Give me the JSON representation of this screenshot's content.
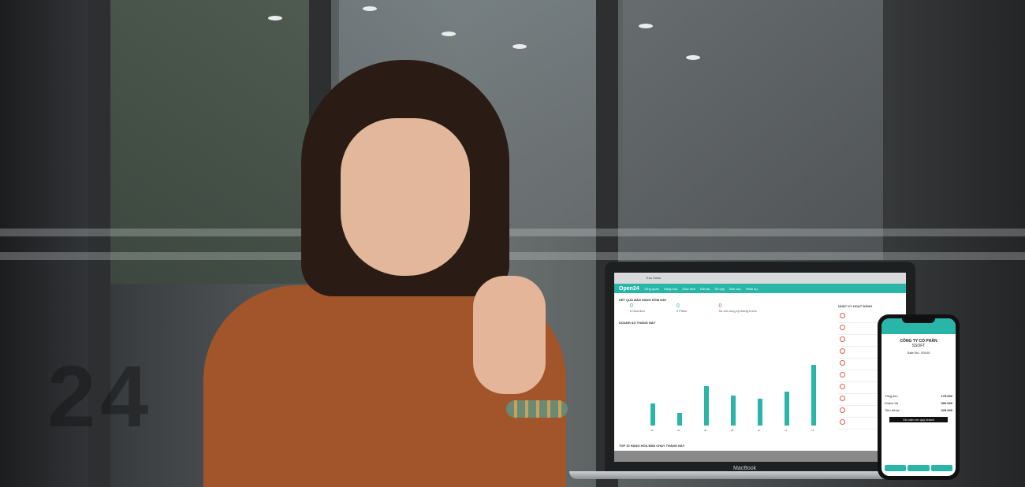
{
  "laptop": {
    "brand": "MacBook",
    "browser_title": "Trao Sinso",
    "app_logo": "Open24",
    "nav": [
      "Tổng quan",
      "Hàng hóa",
      "Giao dịch",
      "Đối tác",
      "Sổ quỹ",
      "Báo cáo",
      "Nhân sự"
    ],
    "panel_title": "KẾT QUẢ BÁN HÀNG HÔM NAY",
    "stats": [
      {
        "label": "0 Hóa đơn",
        "value": "0"
      },
      {
        "label": "0 Phiếu",
        "value": "0"
      },
      {
        "label": "So với cùng kỳ tháng trước",
        "value": "0"
      }
    ],
    "chart_title": "DOANH SỐ THÁNG NÀY",
    "activity_title": "NHẬT KÝ HOẠT ĐỘNG",
    "bottom_title": "TOP 10 HÀNG HÓA BÁN CHẠY THÁNG NÀY"
  },
  "phone": {
    "company": "CÔNG TY CỔ PHẦN",
    "company2": "SSOFT",
    "sale_no": "Sale No.: 00100",
    "total_label": "Tổng tiền",
    "total_value": "175.000",
    "paid_label": "Khách trả",
    "paid_value": "500.000",
    "change_label": "Tiền trả lại",
    "change_value": "325.000",
    "thanks": "Xin cảm ơn quý khách"
  },
  "chart_data": {
    "type": "bar",
    "categories": [
      "02",
      "04",
      "06",
      "08",
      "10",
      "12",
      "13"
    ],
    "values": [
      3.85,
      2.25,
      7.0,
      5.25,
      4.7,
      6.0,
      10.75
    ],
    "ylim": [
      0,
      12.5
    ]
  }
}
